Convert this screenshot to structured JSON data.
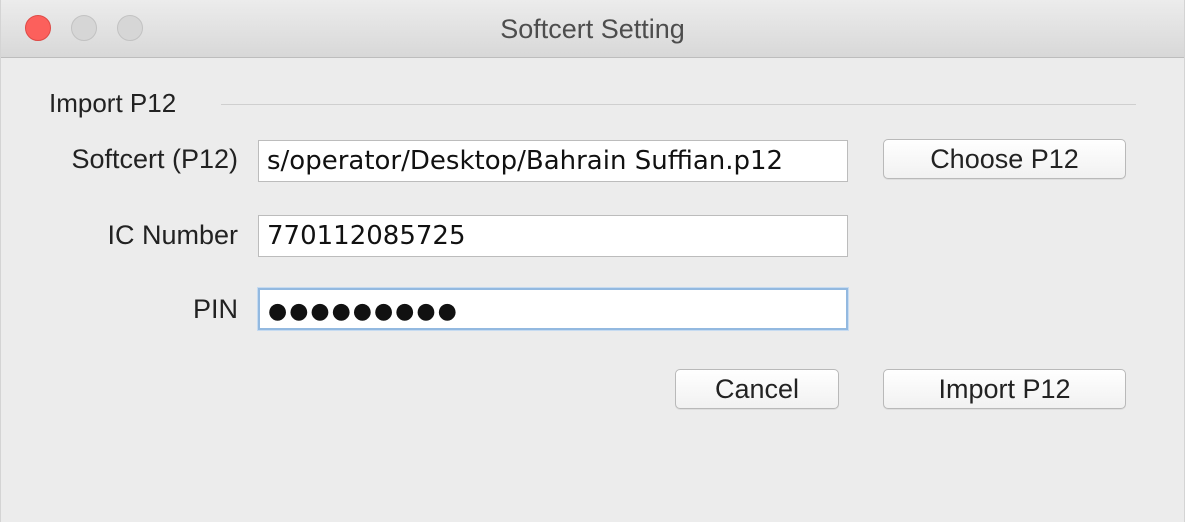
{
  "window": {
    "title": "Softcert Setting"
  },
  "section": {
    "title": "Import P12"
  },
  "fields": {
    "softcert": {
      "label": "Softcert (P12)",
      "value": "s/operator/Desktop/Bahrain Suffian.p12"
    },
    "ic_number": {
      "label": "IC Number",
      "value": "770112085725"
    },
    "pin": {
      "label": "PIN",
      "masked_value": "●●●●●●●●●"
    }
  },
  "buttons": {
    "choose": "Choose P12",
    "cancel": "Cancel",
    "import": "Import P12"
  },
  "colors": {
    "close_button": "#fc605c",
    "focus_ring": "#93b9e0"
  }
}
